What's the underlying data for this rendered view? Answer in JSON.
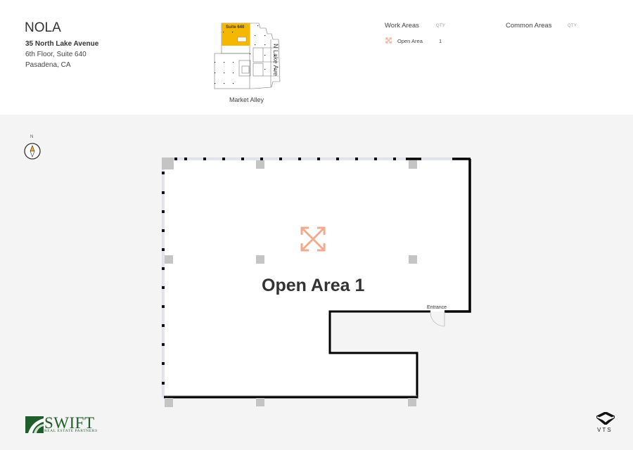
{
  "header": {
    "title": "NOLA",
    "address_line1": "35 North Lake Avenue",
    "address_line2": "6th Floor, Suite 640",
    "address_line3": "Pasadena, CA"
  },
  "keyplan": {
    "suite_label": "Suite 640",
    "street_right": "N Lake Ave",
    "street_bottom": "Market Alley",
    "highlight_color": "#f5b800"
  },
  "legend": {
    "work_areas": {
      "title": "Work Areas",
      "qty_label": "QTY",
      "items": [
        {
          "icon": "expand-arrows-icon",
          "label": "Open Area",
          "qty": "1"
        }
      ]
    },
    "common_areas": {
      "title": "Common Areas",
      "qty_label": "QTY",
      "items": []
    }
  },
  "compass": {
    "label": "N"
  },
  "floorplan": {
    "room_label": "Open Area 1",
    "entrance_label": "Entrance",
    "room_icon": "expand-arrows-icon",
    "icon_color": "#f2ab8c"
  },
  "footer": {
    "swift_brand": "SWIFT",
    "swift_sub": "REAL ESTATE PARTNERS",
    "swift_color": "#1f5e2a",
    "vts_label": "VTS"
  }
}
